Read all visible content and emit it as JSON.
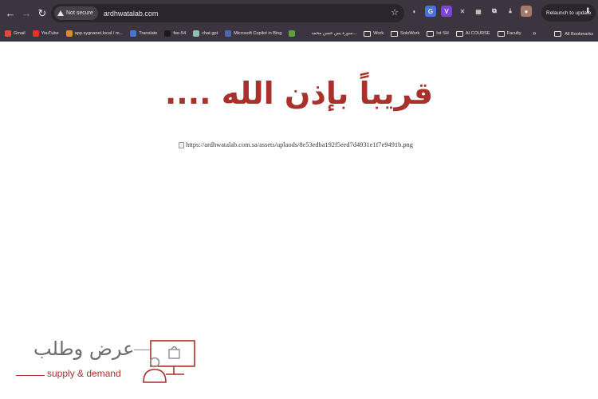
{
  "browser": {
    "url": "ardhwatalab.com",
    "security_label": "Not secure",
    "relaunch_label": "Relaunch to update",
    "extensions": [
      {
        "name": "circle-ext",
        "glyph": "◐",
        "color": "#3c3540"
      },
      {
        "name": "translate-ext",
        "glyph": "G",
        "color": "#4a73d6"
      },
      {
        "name": "v-ext",
        "glyph": "V",
        "color": "#7b45d8"
      },
      {
        "name": "puzzle-x-ext",
        "glyph": "✕",
        "color": "#3c3540"
      },
      {
        "name": "grid-ext",
        "glyph": "▦",
        "color": "#3c3540"
      },
      {
        "name": "puzzle-ext",
        "glyph": "⧉",
        "color": "#3c3540"
      },
      {
        "name": "download-ext",
        "glyph": "⤓",
        "color": "#3c3540"
      },
      {
        "name": "avatar-ext",
        "glyph": "●",
        "color": "#a07b68"
      }
    ]
  },
  "bookmarks": [
    {
      "label": "Gmail",
      "icon": "gmail-icon",
      "color": "#e04a3a"
    },
    {
      "label": "YouTube",
      "icon": "youtube-icon",
      "color": "#e8302a"
    },
    {
      "label": "app.sygnanet.local / m...",
      "icon": "app-icon",
      "color": "#e28a2a"
    },
    {
      "label": "Translate",
      "icon": "translate-icon",
      "color": "#4a73d6"
    },
    {
      "label": "fee-54",
      "icon": "github-icon",
      "color": "#1b1b1b"
    },
    {
      "label": "chat gpt",
      "icon": "chatgpt-icon",
      "color": "#8fbfae"
    },
    {
      "label": "Microsoft Copilot in Bing",
      "icon": "copilot-icon",
      "color": "#4968b0"
    },
    {
      "label": "",
      "icon": "android-icon",
      "color": "#5aa33a"
    },
    {
      "label": "سورة يس حسن محمد...",
      "icon": "quran-icon",
      "color": "#3c3540"
    },
    {
      "label": "Work",
      "icon": "folder-icon",
      "color": ""
    },
    {
      "label": "SoloWork",
      "icon": "folder-icon",
      "color": ""
    },
    {
      "label": "Iot SH",
      "icon": "folder-icon",
      "color": ""
    },
    {
      "label": "AI COURSE",
      "icon": "folder-icon",
      "color": ""
    },
    {
      "label": "Faculty",
      "icon": "folder-icon",
      "color": ""
    }
  ],
  "bookmarks_more": "»",
  "all_bookmarks_label": "All Bookmarks",
  "page": {
    "headline": "قريباً بإذن الله ....",
    "broken_image_alt": "https://ardhwatalab.com.sa/assets/uplaods/8e53edba192f5eed7d4931e1f7e9491b.png",
    "logo_arabic": "عرض وطلب",
    "logo_english": "supply & demand",
    "accent": "#a8312b"
  }
}
